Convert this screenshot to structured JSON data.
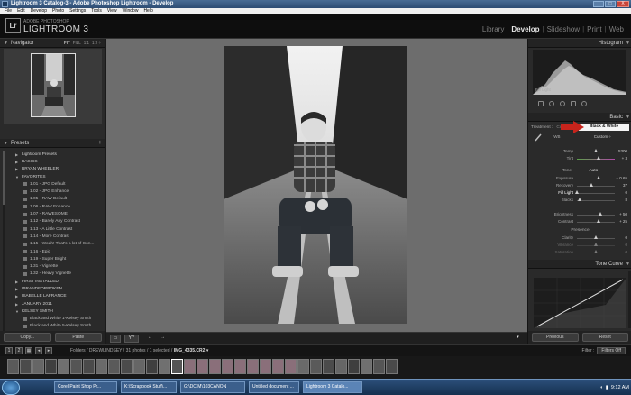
{
  "window": {
    "title": "Lightroom 3 Catalog-3 - Adobe Photoshop Lightroom - Develop",
    "min": "_",
    "max": "□",
    "close": "X"
  },
  "menu": [
    "File",
    "Edit",
    "Develop",
    "Photo",
    "Settings",
    "Tools",
    "View",
    "Window",
    "Help"
  ],
  "header": {
    "logo_letters": "Lr",
    "brand_sub": "ADOBE PHOTOSHOP",
    "brand_main": "LIGHTROOM 3",
    "modules": [
      {
        "label": "Library",
        "active": false
      },
      {
        "label": "Develop",
        "active": true
      },
      {
        "label": "Slideshow",
        "active": false
      },
      {
        "label": "Print",
        "active": false
      },
      {
        "label": "Web",
        "active": false
      }
    ],
    "separator": "|"
  },
  "navigator": {
    "title": "Navigator",
    "zooms": [
      "FIT",
      "FILL",
      "1:1",
      "1:2 ÷"
    ]
  },
  "presets": {
    "title": "Presets",
    "add": "+",
    "folders_top": [
      "Lightroom Presets",
      "BASICS",
      "BRYAN WHEELER"
    ],
    "favorites_label": "FAVORITES",
    "favorites": [
      "1.01 - JPG Default",
      "1.02 - JPG Enhance",
      "1.05 - RAW Default",
      "1.06 - RAW Enhance",
      "1.07 - RAWESOME",
      "1.12 - Barely Any Contrast",
      "1.13 - A Little Contrast",
      "1.14 - More Contrast",
      "1.15 - Woah! That's a lot of Con...",
      "1.16 - Epic",
      "1.19 - Super Bright",
      "1.31 - Vignette",
      "1.32 - Heavy Vignette"
    ],
    "folders_bottom": [
      "FIRST INSTALLED",
      "IBRANDFORBOKEN",
      "ISABELLE LAFRANCE",
      "JANUARY 2011",
      "KELSEY SMITH"
    ],
    "kelsey_items": [
      "Black and White 1-Kelsey Smith",
      "Black and White 5-Kelsey Smith"
    ]
  },
  "left_buttons": {
    "copy": "Copy...",
    "paste": "Paste"
  },
  "right_panel": {
    "histogram_title": "Histogram",
    "histogram_label": "Fill Light",
    "basic_title": "Basic",
    "treatment_label": "Treatment :",
    "color_label": "Color",
    "bw_label": "Black & White",
    "wb_label": "WB :",
    "wb_value": "Custom ÷",
    "temp": {
      "label": "Temp",
      "value": "5300"
    },
    "tint": {
      "label": "Tint",
      "value": "+ 3"
    },
    "tone_label": "Tone",
    "auto_label": "Auto",
    "sliders": [
      {
        "label": "Exposure",
        "value": "+ 0.65",
        "pos": 0.58
      },
      {
        "label": "Recovery",
        "value": "37",
        "pos": 0.37
      },
      {
        "label": "Fill Light",
        "value": "0",
        "pos": 0.0
      },
      {
        "label": "Blacks",
        "value": "8",
        "pos": 0.08
      },
      {
        "label": "Brightness",
        "value": "+ 50",
        "pos": 0.62
      },
      {
        "label": "Contrast",
        "value": "+ 25",
        "pos": 0.56
      }
    ],
    "presence_label": "Presence",
    "presence": [
      {
        "label": "Clarity",
        "value": "0"
      },
      {
        "label": "Vibrance",
        "value": "0"
      },
      {
        "label": "Saturation",
        "value": "0"
      }
    ],
    "tone_curve_title": "Tone Curve"
  },
  "right_buttons": {
    "previous": "Previous",
    "reset": "Reset"
  },
  "toolbar": {
    "view_icon": "▭",
    "compare_icon": "YY",
    "back": "←",
    "forward": "→",
    "menu": "▾"
  },
  "filmstrip_bar": {
    "num1": "1",
    "num2": "2",
    "grid": "▦",
    "back": "◂",
    "forward": "▸",
    "path_prefix": "Folders / DREWLINDSEY / 31 photos / 1 selected /",
    "filename": "IMG_4335.CR2 ▾",
    "filter_label": "Filter :",
    "filter_value": "Filters Off"
  },
  "taskbar": {
    "tasks": [
      "Corel Paint Shop Pr...",
      "K:\\Scrapbook Stuff\\...",
      "G:\\DCIM\\103CANON",
      "Untitled document ...",
      "Lightroom 3 Catalo..."
    ],
    "clock": "9:12 AM"
  },
  "colors": {
    "accent": "#c7241c",
    "panel": "#2a2a2a",
    "center": "#6d6d6d"
  }
}
